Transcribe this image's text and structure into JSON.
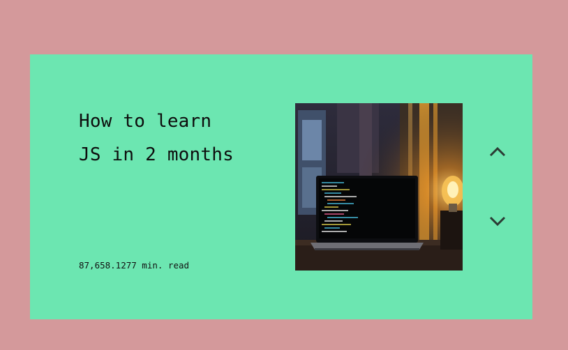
{
  "article": {
    "title_line1": "How to learn",
    "title_line2": "JS in 2 months",
    "read_time": "87,658.1277 min. read",
    "image_subject": "laptop-with-code-and-lamp"
  },
  "navigation": {
    "up_icon": "chevron-up-icon",
    "down_icon": "chevron-down-icon"
  },
  "colors": {
    "page_background": "#d4999b",
    "card_background": "#6ce6b1",
    "text": "#0d0d0d",
    "icon": "#2b3a33"
  }
}
